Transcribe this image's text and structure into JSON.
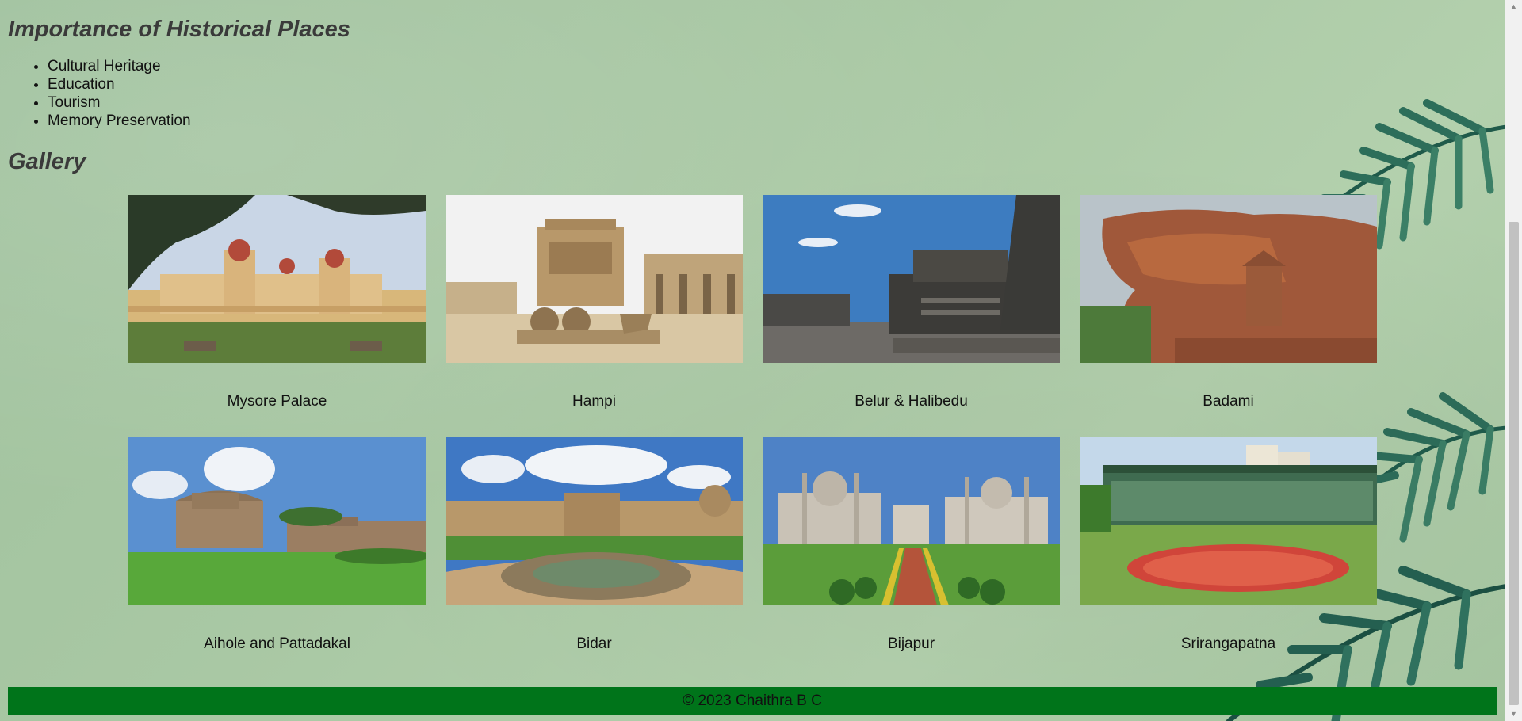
{
  "importance": {
    "heading": "Importance of Historical Places",
    "items": [
      "Cultural Heritage",
      "Education",
      "Tourism",
      "Memory Preservation"
    ]
  },
  "gallery": {
    "heading": "Gallery",
    "items": [
      {
        "caption": "Mysore Palace"
      },
      {
        "caption": "Hampi"
      },
      {
        "caption": "Belur & Halibedu"
      },
      {
        "caption": "Badami"
      },
      {
        "caption": "Aihole and Pattadakal"
      },
      {
        "caption": "Bidar"
      },
      {
        "caption": "Bijapur"
      },
      {
        "caption": "Srirangapatna"
      }
    ]
  },
  "footer": {
    "text": "© 2023 Chaithra B C"
  },
  "colors": {
    "footer_bg": "#00741a",
    "page_bg": "#a9c8a4",
    "heading": "#3a3a3a"
  }
}
